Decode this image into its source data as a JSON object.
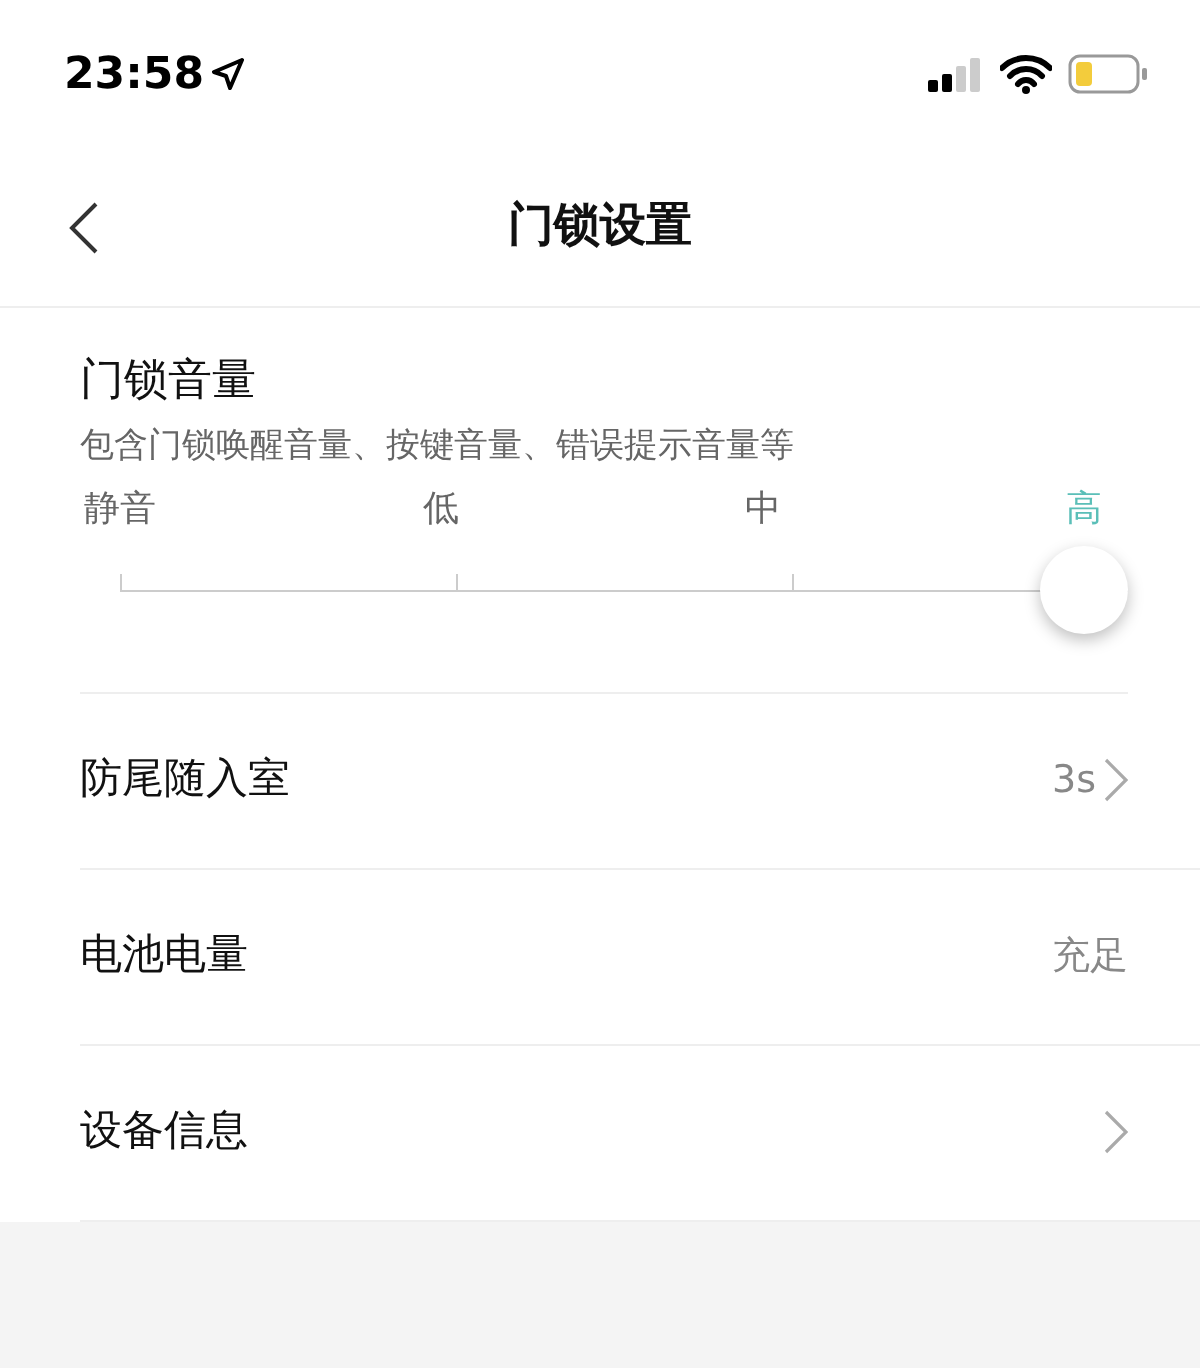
{
  "status_bar": {
    "time": "23:58"
  },
  "nav": {
    "title": "门锁设置"
  },
  "volume": {
    "title": "门锁音量",
    "description": "包含门锁唤醒音量、按键音量、错误提示音量等",
    "level": 1,
    "stops": [
      {
        "label": "静音",
        "selected": false
      },
      {
        "label": "低",
        "selected": false
      },
      {
        "label": "中",
        "selected": false
      },
      {
        "label": "高",
        "selected": true
      }
    ]
  },
  "rows": [
    {
      "label": "防尾随入室",
      "value": "3s",
      "chevron": true
    },
    {
      "label": "电池电量",
      "value": "充足",
      "chevron": false
    },
    {
      "label": "设备信息",
      "chevron": true
    }
  ]
}
